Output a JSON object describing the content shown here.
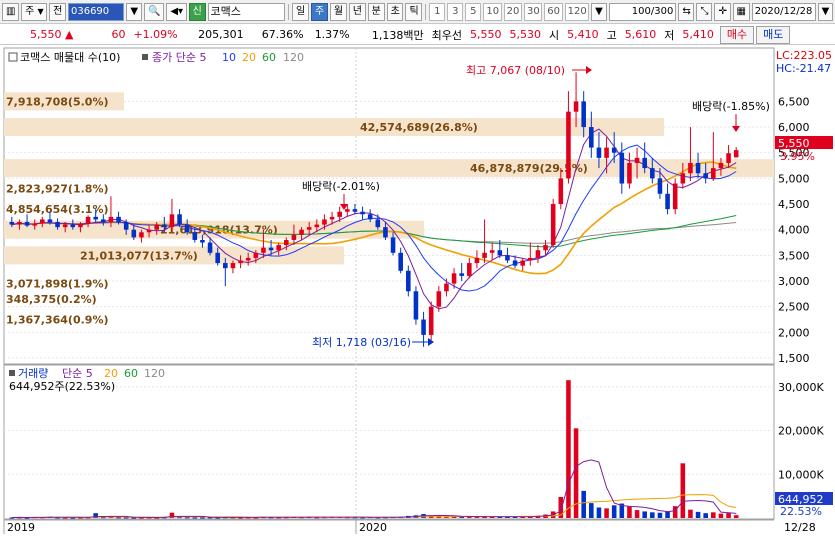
{
  "toolbar": {
    "type_label": "주",
    "prev_label": "전",
    "code": "036690",
    "sin_label": "신",
    "stock_name": "코맥스",
    "periods": [
      "일",
      "주",
      "월",
      "년",
      "분",
      "초",
      "틱"
    ],
    "active_period": "주",
    "intervals": [
      "1",
      "3",
      "5",
      "10",
      "20",
      "30",
      "60",
      "120"
    ],
    "count": "100/300",
    "date": "2020/12/28"
  },
  "quote": {
    "price": "5,550",
    "arrow": "▲",
    "change": "60",
    "change_pct": "+1.09%",
    "volume": "205,301",
    "volume_ratio": "67.36%",
    "turnover": "1.37%",
    "amount": "1,138백만",
    "best_label": "최우선",
    "ask": "5,550",
    "bid": "5,530",
    "open_label": "시",
    "open": "5,410",
    "high_label": "고",
    "high": "5,610",
    "low_label": "저",
    "low": "5,410",
    "buy_label": "매수",
    "sell_label": "매도"
  },
  "price_panel": {
    "legend_name": "코맥스 매물대 수(10)",
    "ma_label": "종가 단순",
    "ma_periods": [
      "5",
      "10",
      "20",
      "60",
      "120"
    ],
    "lc_label": "LC:223.05",
    "hc_label": "HC:-21.47",
    "current_price_tag": "5,550",
    "current_pct_tag": "3.95%",
    "annotations": {
      "high": "최고 7,067 (08/10)",
      "low": "최저 1,718 (03/16)",
      "dividend1": "배당락(-2.01%)",
      "dividend2": "배당락(-1.85%)"
    },
    "volume_profile": [
      {
        "label": "7,918,708(5.0%)",
        "price": 6500
      },
      {
        "label": "2,823,927(1.8%)",
        "price": 4800
      },
      {
        "label": "4,854,654(3.1%)",
        "price": 4400
      },
      {
        "label": "3,071,898(1.9%)",
        "price": 2950
      },
      {
        "label": "348,375(0.2%)",
        "price": 2650
      },
      {
        "label": "1,367,364(0.9%)",
        "price": 2250
      },
      {
        "label": "42,574,689(26.8%)",
        "price": 6000
      },
      {
        "label": "46,878,879(29.5%)",
        "price": 5200
      },
      {
        "label": "21,613,918(13.7%)",
        "price": 4000
      },
      {
        "label": "21,013,077(13.7%)",
        "price": 3500
      }
    ],
    "y_ticks": [
      "6,500",
      "6,000",
      "5,500",
      "5,000",
      "4,500",
      "4,000",
      "3,500",
      "3,000",
      "2,500",
      "2,000",
      "1,500"
    ]
  },
  "volume_panel": {
    "legend_name": "거래량",
    "ma_label": "단순",
    "ma_periods": [
      "5",
      "20",
      "60",
      "120"
    ],
    "current_volume": "644,952주(22.53%)",
    "volume_tag": "644,952",
    "pct_tag": "22.53%",
    "y_ticks": [
      "30,000K",
      "20,000K",
      "10,000K"
    ]
  },
  "x_axis": {
    "labels": [
      "2019",
      "2020"
    ],
    "end_label": "12/28"
  },
  "colors": {
    "up": "#e0001e",
    "down": "#0032c8",
    "ma5": "#7a1fa2",
    "ma10": "#1e3cff",
    "ma20": "#f0a000",
    "ma60": "#1a9a3a",
    "ma120": "#8a8a8a",
    "profile": "#f5e3cc"
  },
  "chart_data": {
    "type": "candlestick",
    "title": "코맥스",
    "candles": [
      {
        "o": 4150,
        "h": 4250,
        "l": 4050,
        "c": 4100
      },
      {
        "o": 4100,
        "h": 4200,
        "l": 4000,
        "c": 4150
      },
      {
        "o": 4150,
        "h": 4300,
        "l": 4050,
        "c": 4080
      },
      {
        "o": 4080,
        "h": 4200,
        "l": 4000,
        "c": 4120
      },
      {
        "o": 4120,
        "h": 4250,
        "l": 4050,
        "c": 4200
      },
      {
        "o": 4200,
        "h": 4350,
        "l": 4100,
        "c": 4150
      },
      {
        "o": 4150,
        "h": 4220,
        "l": 4000,
        "c": 4050
      },
      {
        "o": 4050,
        "h": 4150,
        "l": 3950,
        "c": 4100
      },
      {
        "o": 4100,
        "h": 4200,
        "l": 4000,
        "c": 4050
      },
      {
        "o": 4050,
        "h": 4150,
        "l": 3950,
        "c": 4120
      },
      {
        "o": 4120,
        "h": 4280,
        "l": 4050,
        "c": 4250
      },
      {
        "o": 4250,
        "h": 4400,
        "l": 4150,
        "c": 4200
      },
      {
        "o": 4200,
        "h": 4300,
        "l": 4080,
        "c": 4150
      },
      {
        "o": 4150,
        "h": 4650,
        "l": 4050,
        "c": 4250
      },
      {
        "o": 4250,
        "h": 4350,
        "l": 4100,
        "c": 4150
      },
      {
        "o": 4150,
        "h": 4200,
        "l": 3900,
        "c": 4000
      },
      {
        "o": 4000,
        "h": 4100,
        "l": 3800,
        "c": 3850
      },
      {
        "o": 3850,
        "h": 4000,
        "l": 3750,
        "c": 3950
      },
      {
        "o": 3950,
        "h": 4100,
        "l": 3850,
        "c": 4000
      },
      {
        "o": 4000,
        "h": 4150,
        "l": 3900,
        "c": 4100
      },
      {
        "o": 4100,
        "h": 4250,
        "l": 3950,
        "c": 4050
      },
      {
        "o": 4050,
        "h": 4600,
        "l": 3950,
        "c": 4300
      },
      {
        "o": 4300,
        "h": 4400,
        "l": 4050,
        "c": 4100
      },
      {
        "o": 4100,
        "h": 4200,
        "l": 3900,
        "c": 3950
      },
      {
        "o": 3950,
        "h": 4050,
        "l": 3750,
        "c": 3800
      },
      {
        "o": 3800,
        "h": 3900,
        "l": 3650,
        "c": 3750
      },
      {
        "o": 3750,
        "h": 3850,
        "l": 3500,
        "c": 3550
      },
      {
        "o": 3550,
        "h": 3650,
        "l": 3300,
        "c": 3350
      },
      {
        "o": 3350,
        "h": 3450,
        "l": 2900,
        "c": 3250
      },
      {
        "o": 3250,
        "h": 3400,
        "l": 3150,
        "c": 3350
      },
      {
        "o": 3350,
        "h": 3500,
        "l": 3250,
        "c": 3400
      },
      {
        "o": 3400,
        "h": 3550,
        "l": 3300,
        "c": 3450
      },
      {
        "o": 3450,
        "h": 3600,
        "l": 3350,
        "c": 3550
      },
      {
        "o": 3550,
        "h": 4000,
        "l": 3450,
        "c": 3650
      },
      {
        "o": 3650,
        "h": 3800,
        "l": 3500,
        "c": 3600
      },
      {
        "o": 3600,
        "h": 3750,
        "l": 3500,
        "c": 3700
      },
      {
        "o": 3700,
        "h": 3850,
        "l": 3600,
        "c": 3800
      },
      {
        "o": 3800,
        "h": 4100,
        "l": 3700,
        "c": 3900
      },
      {
        "o": 3900,
        "h": 4050,
        "l": 3800,
        "c": 4000
      },
      {
        "o": 4000,
        "h": 4150,
        "l": 3900,
        "c": 4050
      },
      {
        "o": 4050,
        "h": 4200,
        "l": 3950,
        "c": 4100
      },
      {
        "o": 4100,
        "h": 4300,
        "l": 4000,
        "c": 4200
      },
      {
        "o": 4200,
        "h": 4350,
        "l": 4100,
        "c": 4250
      },
      {
        "o": 4250,
        "h": 4450,
        "l": 4150,
        "c": 4350
      },
      {
        "o": 4350,
        "h": 4500,
        "l": 4250,
        "c": 4400
      },
      {
        "o": 4400,
        "h": 4500,
        "l": 4300,
        "c": 4350
      },
      {
        "o": 4350,
        "h": 4450,
        "l": 4200,
        "c": 4300
      },
      {
        "o": 4300,
        "h": 4400,
        "l": 4150,
        "c": 4200
      },
      {
        "o": 4200,
        "h": 4300,
        "l": 4000,
        "c": 4050
      },
      {
        "o": 4050,
        "h": 4150,
        "l": 3800,
        "c": 3850
      },
      {
        "o": 3850,
        "h": 3950,
        "l": 3500,
        "c": 3550
      },
      {
        "o": 3550,
        "h": 3650,
        "l": 3150,
        "c": 3200
      },
      {
        "o": 3200,
        "h": 3300,
        "l": 2700,
        "c": 2800
      },
      {
        "o": 2800,
        "h": 2900,
        "l": 2150,
        "c": 2250
      },
      {
        "o": 2250,
        "h": 2400,
        "l": 1718,
        "c": 1950
      },
      {
        "o": 1950,
        "h": 2600,
        "l": 1850,
        "c": 2500
      },
      {
        "o": 2500,
        "h": 2900,
        "l": 2400,
        "c": 2800
      },
      {
        "o": 2800,
        "h": 3050,
        "l": 2700,
        "c": 2950
      },
      {
        "o": 2950,
        "h": 3250,
        "l": 2850,
        "c": 3150
      },
      {
        "o": 3150,
        "h": 3350,
        "l": 3000,
        "c": 3100
      },
      {
        "o": 3100,
        "h": 3450,
        "l": 3050,
        "c": 3350
      },
      {
        "o": 3350,
        "h": 3600,
        "l": 3250,
        "c": 3450
      },
      {
        "o": 3450,
        "h": 4200,
        "l": 3350,
        "c": 3550
      },
      {
        "o": 3550,
        "h": 3750,
        "l": 3400,
        "c": 3600
      },
      {
        "o": 3600,
        "h": 3800,
        "l": 3450,
        "c": 3500
      },
      {
        "o": 3500,
        "h": 3650,
        "l": 3350,
        "c": 3400
      },
      {
        "o": 3400,
        "h": 3500,
        "l": 3250,
        "c": 3300
      },
      {
        "o": 3300,
        "h": 3450,
        "l": 3200,
        "c": 3400
      },
      {
        "o": 3400,
        "h": 3750,
        "l": 3300,
        "c": 3450
      },
      {
        "o": 3450,
        "h": 3700,
        "l": 3350,
        "c": 3600
      },
      {
        "o": 3600,
        "h": 3800,
        "l": 3500,
        "c": 3700
      },
      {
        "o": 3700,
        "h": 4600,
        "l": 3650,
        "c": 4500
      },
      {
        "o": 4500,
        "h": 5200,
        "l": 4400,
        "c": 5000
      },
      {
        "o": 5000,
        "h": 6700,
        "l": 4900,
        "c": 6300
      },
      {
        "o": 6300,
        "h": 7067,
        "l": 6000,
        "c": 6500
      },
      {
        "o": 6500,
        "h": 6700,
        "l": 5800,
        "c": 6000
      },
      {
        "o": 6000,
        "h": 6300,
        "l": 5400,
        "c": 5600
      },
      {
        "o": 5600,
        "h": 5900,
        "l": 5200,
        "c": 5400
      },
      {
        "o": 5400,
        "h": 5800,
        "l": 5100,
        "c": 5600
      },
      {
        "o": 5600,
        "h": 5900,
        "l": 5300,
        "c": 5500
      },
      {
        "o": 5500,
        "h": 5700,
        "l": 4700,
        "c": 4900
      },
      {
        "o": 4900,
        "h": 5500,
        "l": 4800,
        "c": 5300
      },
      {
        "o": 5300,
        "h": 5600,
        "l": 5000,
        "c": 5400
      },
      {
        "o": 5400,
        "h": 5700,
        "l": 5100,
        "c": 5200
      },
      {
        "o": 5200,
        "h": 5400,
        "l": 4900,
        "c": 5000
      },
      {
        "o": 5000,
        "h": 5200,
        "l": 4600,
        "c": 4700
      },
      {
        "o": 4700,
        "h": 4900,
        "l": 4300,
        "c": 4400
      },
      {
        "o": 4400,
        "h": 5000,
        "l": 4300,
        "c": 4900
      },
      {
        "o": 4900,
        "h": 5300,
        "l": 4800,
        "c": 5100
      },
      {
        "o": 5100,
        "h": 6000,
        "l": 4950,
        "c": 5300
      },
      {
        "o": 5300,
        "h": 5500,
        "l": 5000,
        "c": 5100
      },
      {
        "o": 5100,
        "h": 5300,
        "l": 4900,
        "c": 5000
      },
      {
        "o": 5000,
        "h": 5900,
        "l": 4950,
        "c": 5200
      },
      {
        "o": 5200,
        "h": 5400,
        "l": 5050,
        "c": 5300
      },
      {
        "o": 5300,
        "h": 5650,
        "l": 5200,
        "c": 5490
      },
      {
        "o": 5410,
        "h": 5610,
        "l": 5410,
        "c": 5550
      }
    ],
    "volume": [
      120,
      150,
      90,
      200,
      180,
      300,
      140,
      110,
      95,
      130,
      160,
      1100,
      180,
      220,
      150,
      130,
      100,
      120,
      140,
      110,
      170,
      1200,
      210,
      160,
      130,
      120,
      140,
      110,
      180,
      160,
      120,
      150,
      130,
      200,
      170,
      150,
      180,
      260,
      190,
      220,
      160,
      200,
      250,
      230,
      190,
      170,
      150,
      210,
      160,
      180,
      220,
      260,
      480,
      620,
      900,
      520,
      430,
      380,
      350,
      300,
      320,
      300,
      280,
      340,
      260,
      240,
      280,
      300,
      450,
      520,
      800,
      1500,
      4800,
      31500,
      20500,
      6200,
      3400,
      2400,
      2200,
      2900,
      3300,
      2600,
      1800,
      1500,
      1300,
      1200,
      1500,
      2700,
      12500,
      1900,
      1400,
      1100,
      1300,
      1000,
      1200,
      645
    ],
    "ylim": [
      1500,
      6800
    ],
    "volume_ylim": [
      0,
      32000
    ]
  }
}
